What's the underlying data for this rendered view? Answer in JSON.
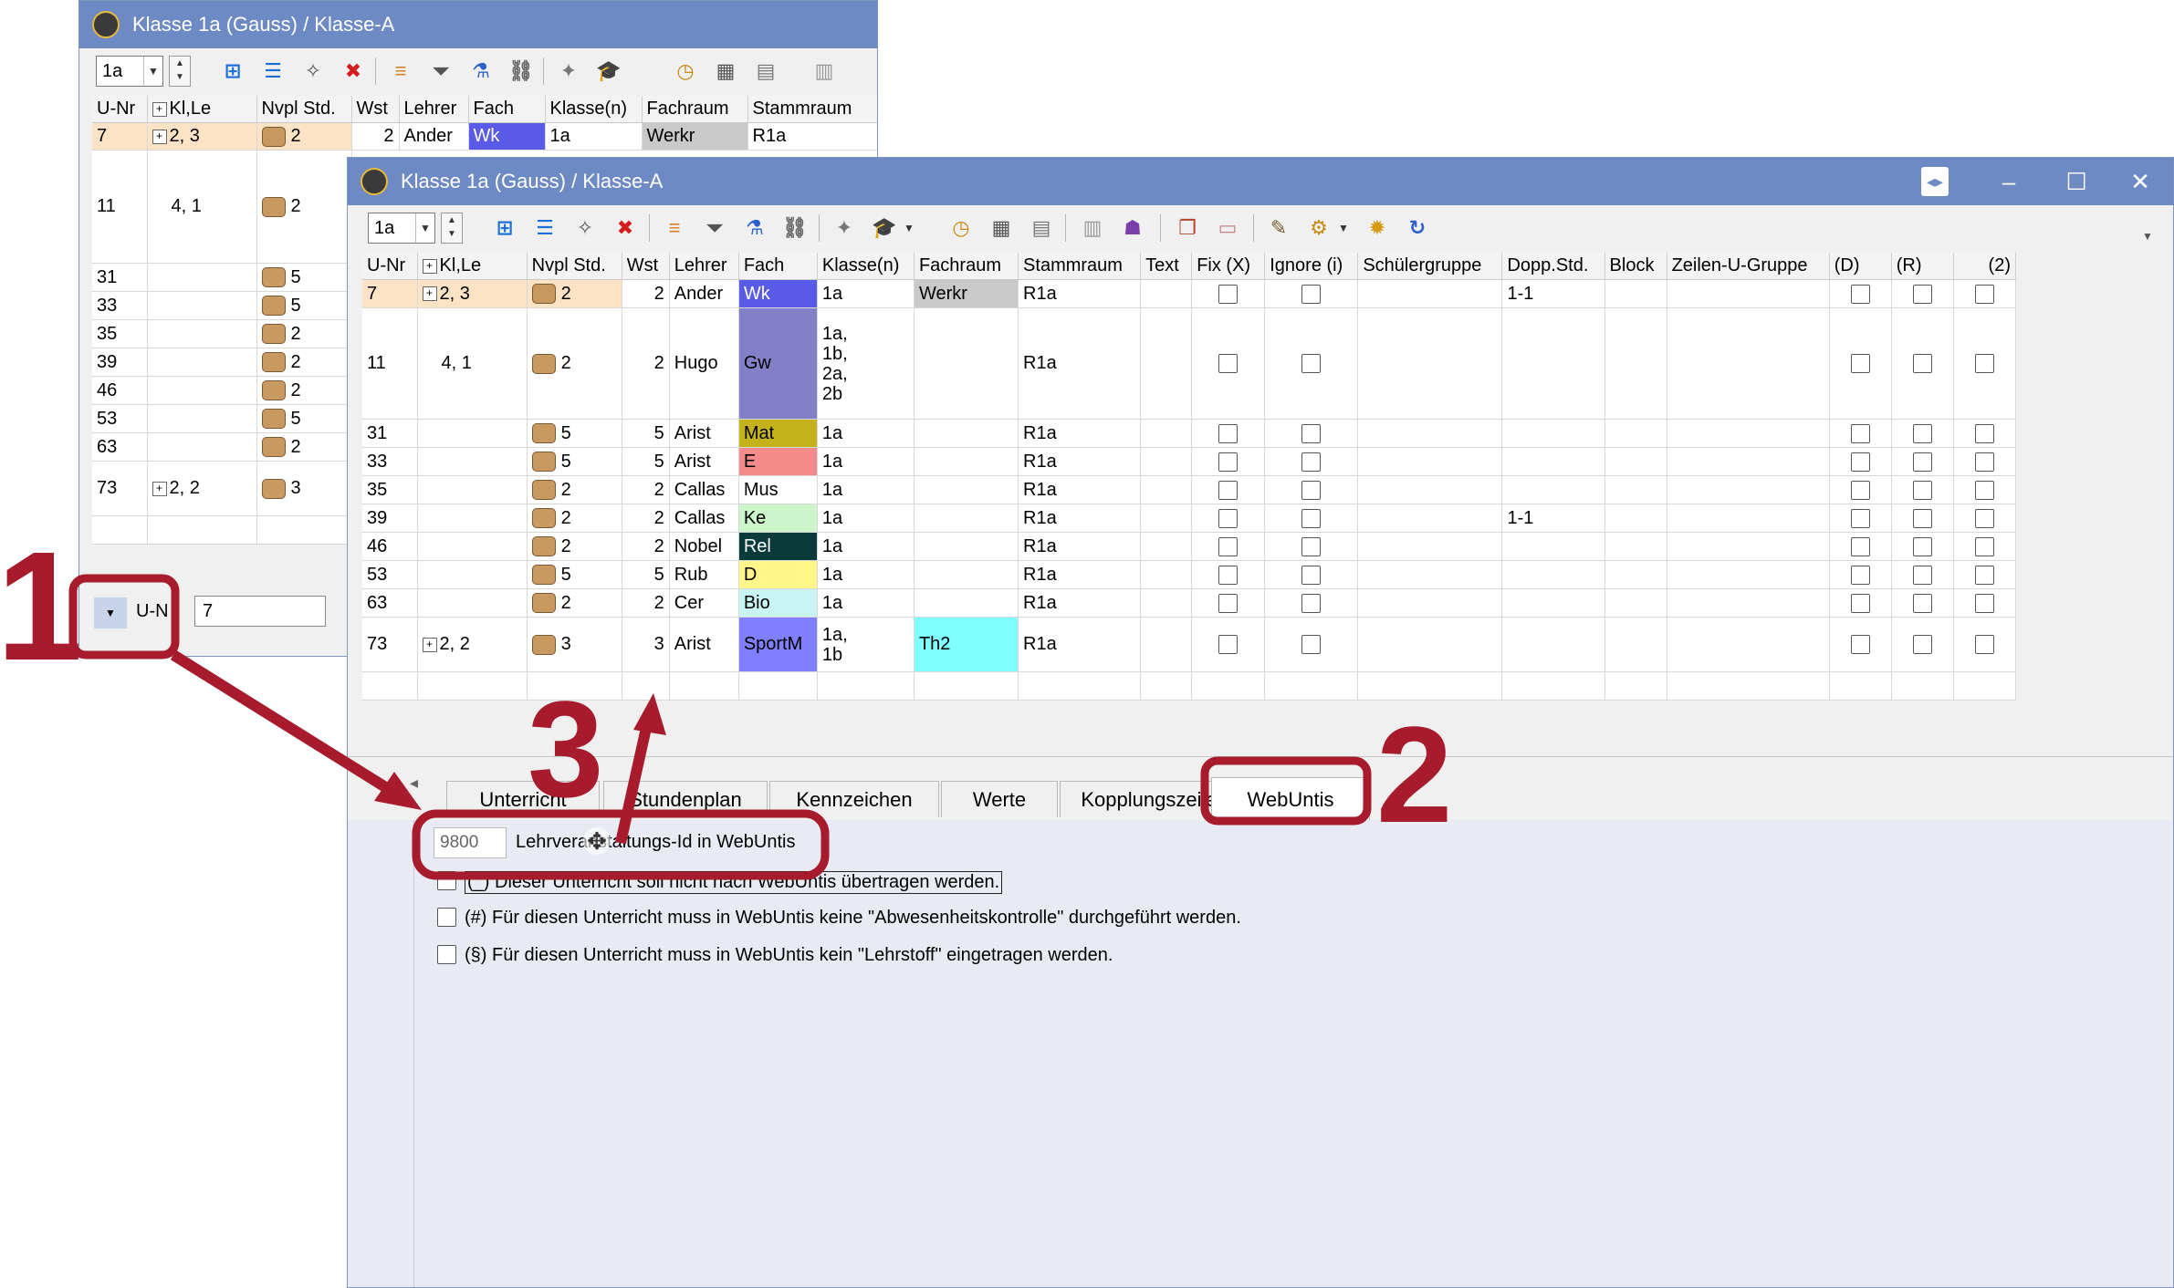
{
  "back_window": {
    "title": "Klasse 1a (Gauss) / Klasse-A",
    "class_combo": "1a",
    "columns": [
      "U-Nr",
      "Kl,Le",
      "Nvpl Std.",
      "Wst",
      "Lehrer",
      "Fach",
      "Klasse(n)",
      "Fachraum",
      "Stammraum"
    ],
    "rows": [
      {
        "unr": "7",
        "klle": "2, 3",
        "nvpl": "2",
        "wst": "2",
        "lehrer": "Ander",
        "fach": "Wk",
        "klassen": "1a",
        "fachraum": "Werkr",
        "stammraum": "R1a"
      },
      {
        "unr": "11",
        "klle": "4, 1",
        "nvpl": "2"
      },
      {
        "unr": "31",
        "klle": "",
        "nvpl": "5"
      },
      {
        "unr": "33",
        "klle": "",
        "nvpl": "5"
      },
      {
        "unr": "35",
        "klle": "",
        "nvpl": "2"
      },
      {
        "unr": "39",
        "klle": "",
        "nvpl": "2"
      },
      {
        "unr": "46",
        "klle": "",
        "nvpl": "2"
      },
      {
        "unr": "53",
        "klle": "",
        "nvpl": "5"
      },
      {
        "unr": "63",
        "klle": "",
        "nvpl": "2"
      },
      {
        "unr": "73",
        "klle": "2, 2",
        "nvpl": "3"
      }
    ],
    "footer": {
      "field_label": "U-N",
      "field_value": "7"
    }
  },
  "front_window": {
    "title": "Klasse 1a (Gauss) / Klasse-A",
    "class_combo": "1a",
    "columns": [
      "U-Nr",
      "Kl,Le",
      "Nvpl Std.",
      "Wst",
      "Lehrer",
      "Fach",
      "Klasse(n)",
      "Fachraum",
      "Stammraum",
      "Text",
      "Fix (X)",
      "Ignore (i)",
      "Schülergruppe",
      "Dopp.Std.",
      "Block",
      "Zeilen-U-Gruppe",
      "(D)",
      "(R)",
      "(2)"
    ],
    "rows": [
      {
        "unr": "7",
        "klle": "2, 3",
        "nvpl": "2",
        "wst": "2",
        "lehrer": "Ander",
        "fach": "Wk",
        "klassen": [
          "1a"
        ],
        "fachraum": "Werkr",
        "stammraum": "R1a",
        "dopp": "1-1"
      },
      {
        "unr": "11",
        "klle": "4, 1",
        "nvpl": "2",
        "wst": "2",
        "lehrer": "Hugo",
        "fach": "Gw",
        "klassen": [
          "1a,",
          "1b,",
          "2a,",
          "2b"
        ],
        "fachraum": "",
        "stammraum": "R1a",
        "dopp": ""
      },
      {
        "unr": "31",
        "klle": "",
        "nvpl": "5",
        "wst": "5",
        "lehrer": "Arist",
        "fach": "Mat",
        "klassen": [
          "1a"
        ],
        "fachraum": "",
        "stammraum": "R1a",
        "dopp": ""
      },
      {
        "unr": "33",
        "klle": "",
        "nvpl": "5",
        "wst": "5",
        "lehrer": "Arist",
        "fach": "E",
        "klassen": [
          "1a"
        ],
        "fachraum": "",
        "stammraum": "R1a",
        "dopp": ""
      },
      {
        "unr": "35",
        "klle": "",
        "nvpl": "2",
        "wst": "2",
        "lehrer": "Callas",
        "fach": "Mus",
        "klassen": [
          "1a"
        ],
        "fachraum": "",
        "stammraum": "R1a",
        "dopp": ""
      },
      {
        "unr": "39",
        "klle": "",
        "nvpl": "2",
        "wst": "2",
        "lehrer": "Callas",
        "fach": "Ke",
        "klassen": [
          "1a"
        ],
        "fachraum": "",
        "stammraum": "R1a",
        "dopp": "1-1"
      },
      {
        "unr": "46",
        "klle": "",
        "nvpl": "2",
        "wst": "2",
        "lehrer": "Nobel",
        "fach": "Rel",
        "klassen": [
          "1a"
        ],
        "fachraum": "",
        "stammraum": "R1a",
        "dopp": ""
      },
      {
        "unr": "53",
        "klle": "",
        "nvpl": "5",
        "wst": "5",
        "lehrer": "Rub",
        "fach": "D",
        "klassen": [
          "1a"
        ],
        "fachraum": "",
        "stammraum": "R1a",
        "dopp": ""
      },
      {
        "unr": "63",
        "klle": "",
        "nvpl": "2",
        "wst": "2",
        "lehrer": "Cer",
        "fach": "Bio",
        "klassen": [
          "1a"
        ],
        "fachraum": "",
        "stammraum": "R1a",
        "dopp": ""
      },
      {
        "unr": "73",
        "klle": "2, 2",
        "nvpl": "3",
        "wst": "3",
        "lehrer": "Arist",
        "fach": "SportM",
        "klassen": [
          "1a,",
          "1b"
        ],
        "fachraum": "Th2",
        "stammraum": "R1a",
        "dopp": ""
      }
    ],
    "tabs": [
      "Unterricht",
      "Stundenplan",
      "Kennzeichen",
      "Werte",
      "Kopplungszeile",
      "WebUntis"
    ],
    "active_tab": "WebUntis",
    "webuntis": {
      "id_value": "9800",
      "id_label": "Lehrveranstaltungs-Id in WebUntis",
      "cb1_label": "(_) Dieser Unterricht soll nicht nach WebUntis übertragen werden.",
      "cb2_label": "(#) Für diesen Unterricht muss in WebUntis keine \"Abwesenheitskontrolle\" durchgeführt werden.",
      "cb3_label": "(§) Für diesen Unterricht muss in WebUntis kein \"Lehrstoff\" eingetragen werden."
    }
  },
  "subject_colors": {
    "Wk": "#5a5ae8",
    "Gw": "#8480c8",
    "Mat": "#c4b21a",
    "E": "#f48a8a",
    "Mus": "#ffffff",
    "Ke": "#ccf5cc",
    "Rel": "#0a3a3a",
    "D": "#fff588",
    "Bio": "#c8f4f4",
    "SportM": "#8080ff"
  },
  "annotations": {
    "step1": "1",
    "step2": "2",
    "step3": "3",
    "color": "#a71b2c"
  }
}
